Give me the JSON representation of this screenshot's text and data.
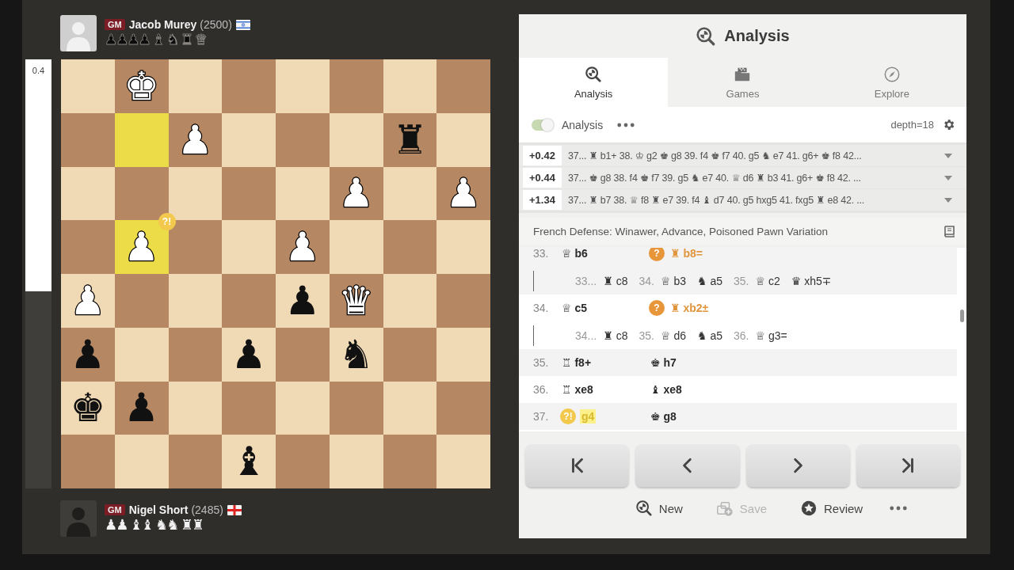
{
  "players": [
    {
      "title": "GM",
      "name": "Jacob Murey",
      "rating": "(2500)",
      "flag": {
        "kind": "israel"
      },
      "captured": {
        "text": "♟♟♟♟ ♝ ♞ ♜ ♛",
        "kind": "black"
      }
    },
    {
      "title": "GM",
      "name": "Nigel Short",
      "rating": "(2485)",
      "flag": {
        "kind": "england"
      },
      "captured": {
        "text": "♟♟ ♝♝ ♞♞ ♜♜",
        "kind": "white"
      }
    }
  ],
  "eval": {
    "label": "0.4",
    "level": 0.54
  },
  "board": {
    "ranks": [
      {
        "squares": [
          {
            "highlighted": false
          },
          {
            "highlighted": false,
            "piece": {
              "glyph": "♚",
              "kind": "white"
            }
          },
          {
            "highlighted": false
          },
          {
            "highlighted": false
          },
          {
            "highlighted": false
          },
          {
            "highlighted": false
          },
          {
            "highlighted": false
          },
          {
            "highlighted": false
          }
        ]
      },
      {
        "squares": [
          {
            "highlighted": false
          },
          {
            "highlighted": true
          },
          {
            "highlighted": false,
            "piece": {
              "glyph": "♟",
              "kind": "white"
            }
          },
          {
            "highlighted": false
          },
          {
            "highlighted": false
          },
          {
            "highlighted": false
          },
          {
            "highlighted": false,
            "piece": {
              "glyph": "♜",
              "kind": "black"
            }
          },
          {
            "highlighted": false
          }
        ]
      },
      {
        "squares": [
          {
            "highlighted": false
          },
          {
            "highlighted": false
          },
          {
            "highlighted": false
          },
          {
            "highlighted": false
          },
          {
            "highlighted": false
          },
          {
            "highlighted": false,
            "piece": {
              "glyph": "♟",
              "kind": "white"
            }
          },
          {
            "highlighted": false
          },
          {
            "highlighted": false,
            "piece": {
              "glyph": "♟",
              "kind": "white"
            }
          }
        ]
      },
      {
        "squares": [
          {
            "highlighted": false
          },
          {
            "highlighted": true,
            "piece": {
              "glyph": "♟",
              "kind": "white"
            },
            "annotation": {
              "symbol": "?!",
              "kind": "inaccuracy"
            }
          },
          {
            "highlighted": false
          },
          {
            "highlighted": false
          },
          {
            "highlighted": false,
            "piece": {
              "glyph": "♟",
              "kind": "white"
            }
          },
          {
            "highlighted": false
          },
          {
            "highlighted": false
          },
          {
            "highlighted": false
          }
        ]
      },
      {
        "squares": [
          {
            "highlighted": false,
            "piece": {
              "glyph": "♟",
              "kind": "white"
            }
          },
          {
            "highlighted": false
          },
          {
            "highlighted": false
          },
          {
            "highlighted": false
          },
          {
            "highlighted": false,
            "piece": {
              "glyph": "♟",
              "kind": "black"
            }
          },
          {
            "highlighted": false,
            "piece": {
              "glyph": "♛",
              "kind": "white"
            }
          },
          {
            "highlighted": false
          },
          {
            "highlighted": false
          }
        ]
      },
      {
        "squares": [
          {
            "highlighted": false,
            "piece": {
              "glyph": "♟",
              "kind": "black"
            }
          },
          {
            "highlighted": false
          },
          {
            "highlighted": false
          },
          {
            "highlighted": false,
            "piece": {
              "glyph": "♟",
              "kind": "black"
            }
          },
          {
            "highlighted": false
          },
          {
            "highlighted": false,
            "piece": {
              "glyph": "♞",
              "kind": "black"
            }
          },
          {
            "highlighted": false
          },
          {
            "highlighted": false
          }
        ]
      },
      {
        "squares": [
          {
            "highlighted": false,
            "piece": {
              "glyph": "♚",
              "kind": "black"
            }
          },
          {
            "highlighted": false,
            "piece": {
              "glyph": "♟",
              "kind": "black"
            }
          },
          {
            "highlighted": false
          },
          {
            "highlighted": false
          },
          {
            "highlighted": false
          },
          {
            "highlighted": false
          },
          {
            "highlighted": false
          },
          {
            "highlighted": false
          }
        ]
      },
      {
        "squares": [
          {
            "highlighted": false
          },
          {
            "highlighted": false
          },
          {
            "highlighted": false
          },
          {
            "highlighted": false,
            "piece": {
              "glyph": "♝",
              "kind": "black"
            }
          },
          {
            "highlighted": false
          },
          {
            "highlighted": false
          },
          {
            "highlighted": false
          },
          {
            "highlighted": false
          }
        ]
      }
    ]
  },
  "panel": {
    "title": "Analysis",
    "tabs": [
      {
        "label": "Analysis",
        "kind": "analysis",
        "selected": true
      },
      {
        "label": "Games",
        "kind": "games",
        "selected": false
      },
      {
        "label": "Explore",
        "kind": "explore",
        "selected": false
      }
    ],
    "engine": {
      "on": true,
      "label": "Analysis",
      "depth": "depth=18"
    },
    "lines": [
      {
        "score": "+0.42",
        "moves": "37... ♜ b1+ 38. ♔ g2 ♚ g8 39. f4 ♚ f7 40. g5 ♞ e7 41. g6+ ♚ f8 42..."
      },
      {
        "score": "+0.44",
        "moves": "37... ♚ g8 38. f4 ♚ f7 39. g5 ♞ e7 40. ♕ d6 ♜ b3 41. g6+ ♚ f8 42. ..."
      },
      {
        "score": "+1.34",
        "moves": "37... ♜ b7 38. ♕ f8 ♜ e7 39. f4 ♝ d7 40. g5 hxg5 41. fxg5 ♜ e8 42. ..."
      }
    ],
    "opening": "French Defense: Winawer, Advance, Poisoned Pawn Variation",
    "moves": [
      {
        "number": "33.",
        "white": {
          "text": "♕ b6",
          "selected": false
        },
        "black": {
          "text": "♜ b8=",
          "selected": false,
          "annotation": {
            "symbol": "?",
            "kind": "mistake"
          }
        },
        "variation": [
          {
            "number": "33...",
            "text": "♜ c8",
            "selected": false
          },
          {
            "number": "34.",
            "text": "♕ b3",
            "selected": false
          },
          {
            "text": "♞ a5",
            "selected": false
          },
          {
            "number": "35.",
            "text": "♕ c2",
            "selected": false
          },
          {
            "text": "♛ xh5∓",
            "selected": false
          }
        ]
      },
      {
        "number": "34.",
        "white": {
          "text": "♕ c5",
          "selected": false
        },
        "black": {
          "text": "♜ xb2±",
          "selected": false,
          "annotation": {
            "symbol": "?",
            "kind": "mistake"
          }
        },
        "variation": [
          {
            "number": "34...",
            "text": "♜ c8",
            "selected": false
          },
          {
            "number": "35.",
            "text": "♕ d6",
            "selected": false
          },
          {
            "text": "♞ a5",
            "selected": false
          },
          {
            "number": "36.",
            "text": "♕ g3=",
            "selected": false
          }
        ]
      },
      {
        "number": "35.",
        "white": {
          "text": "♖ f8+",
          "selected": false
        },
        "black": {
          "text": "♚ h7",
          "selected": false
        }
      },
      {
        "number": "36.",
        "white": {
          "text": "♖ xe8",
          "selected": false
        },
        "black": {
          "text": "♝ xe8",
          "selected": false
        }
      },
      {
        "number": "37.",
        "white": {
          "text": "g4",
          "selected": true,
          "annotation": {
            "symbol": "?!",
            "kind": "inaccuracy"
          }
        },
        "black": {
          "text": "♚ g8",
          "selected": false
        }
      }
    ],
    "actions": [
      {
        "label": "New",
        "kind": "new",
        "disabled": false
      },
      {
        "label": "Save",
        "kind": "save",
        "disabled": true
      },
      {
        "label": "Review",
        "kind": "review",
        "disabled": false
      }
    ]
  }
}
